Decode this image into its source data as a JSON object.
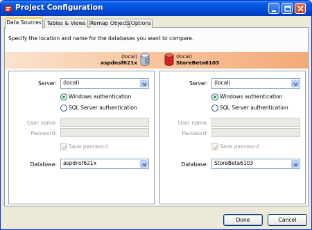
{
  "window": {
    "title": "Project Configuration"
  },
  "tabs": [
    {
      "label": "Data Sources",
      "active": true
    },
    {
      "label": "Tables & Views",
      "active": false
    },
    {
      "label": "Remap Objects",
      "active": false
    },
    {
      "label": "Options",
      "active": false
    }
  ],
  "instruction": "Specify the location and name for the databases you want to compare.",
  "left_db": {
    "server": "(local)",
    "database": "aspdnsf621x"
  },
  "right_db": {
    "server": "(local)",
    "database": "StoreBeta6103"
  },
  "labels": {
    "server": "Server:",
    "windows_auth": "Windows authentication",
    "sql_auth": "SQL Server authentication",
    "user_name": "User name:",
    "password": "Password:",
    "save_password": "Save password",
    "database": "Database:"
  },
  "left_panel": {
    "server_value": "(local)",
    "auth": "windows",
    "database_value": "aspdnsf621x"
  },
  "right_panel": {
    "server_value": "(local)",
    "auth": "windows",
    "database_value": "StoreBeta6103"
  },
  "buttons": {
    "done": "Done",
    "cancel": "Cancel"
  },
  "colors": {
    "titlebar": "#0552dd",
    "band_start": "#fbe3cf",
    "band_end": "#f4a979",
    "left_db_icon": "#8fa3c0",
    "right_db_icon": "#d42323"
  },
  "icons": {
    "app": "app-icon",
    "left_db": "database-cylinder-gray-icon",
    "right_db": "database-cylinder-red-icon"
  }
}
